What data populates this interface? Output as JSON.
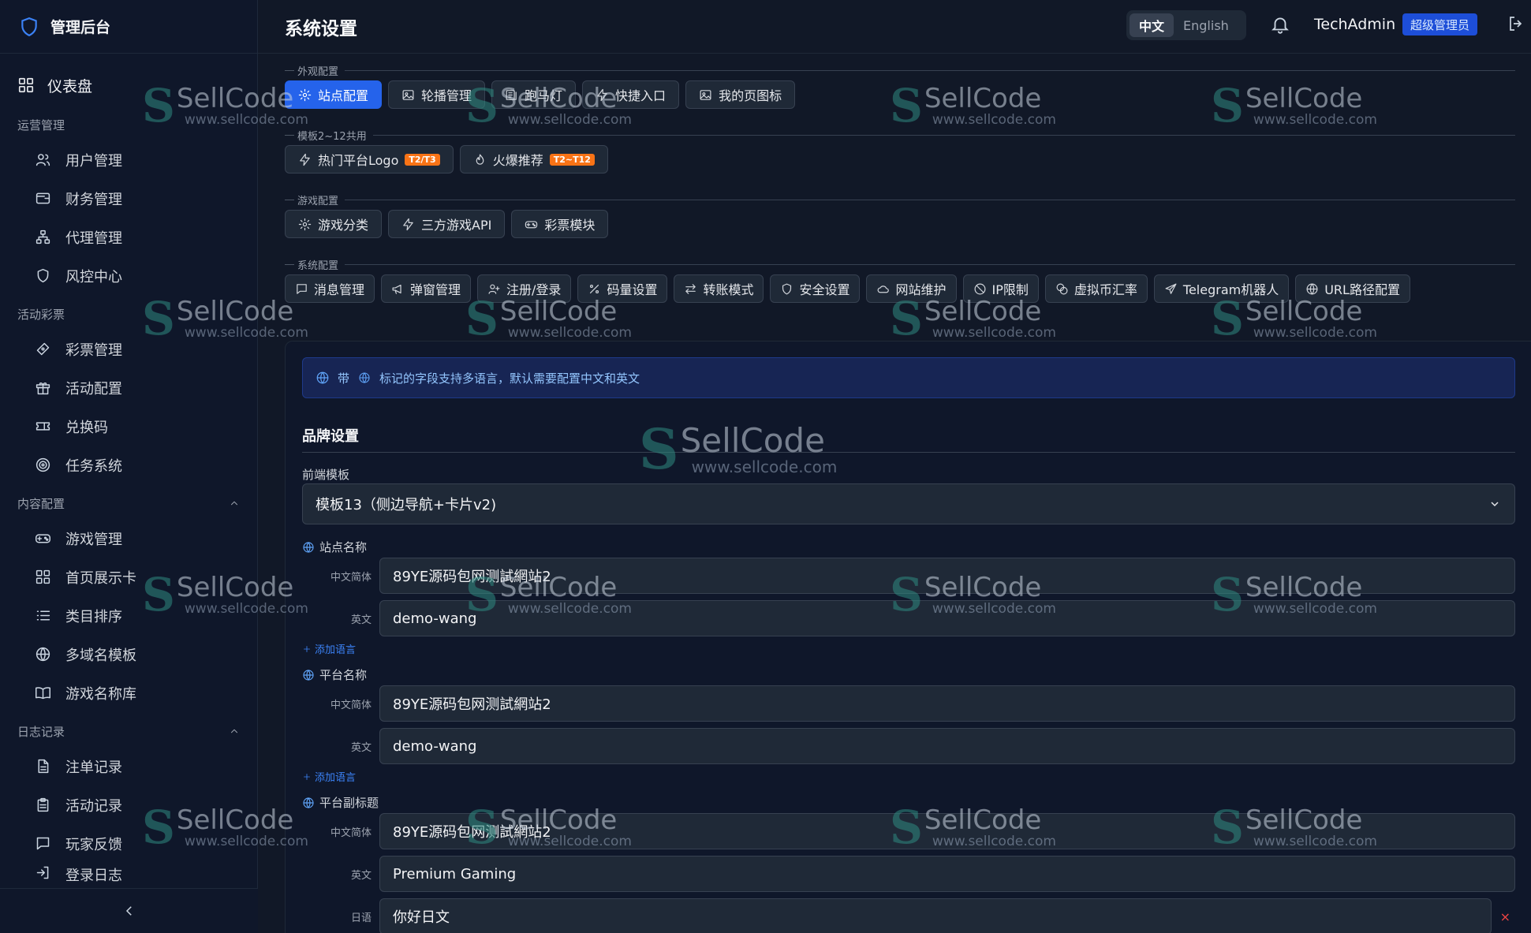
{
  "colors": {
    "accent": "#2563eb",
    "tag": "#f97316",
    "watermark": "#2f8a80",
    "danger": "#ef4444"
  },
  "sidebar": {
    "brand": "管理后台",
    "dashboard": {
      "label": "仪表盘",
      "icon": "grid-icon"
    },
    "groups": [
      {
        "title": "运营管理",
        "items": [
          {
            "label": "用户管理",
            "icon": "users-icon"
          },
          {
            "label": "财务管理",
            "icon": "wallet-icon"
          },
          {
            "label": "代理管理",
            "icon": "network-icon"
          },
          {
            "label": "风控中心",
            "icon": "shield-icon"
          }
        ]
      },
      {
        "title": "活动彩票",
        "items": [
          {
            "label": "彩票管理",
            "icon": "lottery-icon"
          },
          {
            "label": "活动配置",
            "icon": "gift-icon"
          },
          {
            "label": "兑换码",
            "icon": "ticket-icon"
          },
          {
            "label": "任务系统",
            "icon": "target-icon"
          }
        ]
      },
      {
        "title": "内容配置",
        "items": [
          {
            "label": "游戏管理",
            "icon": "gamepad-icon"
          },
          {
            "label": "首页展示卡",
            "icon": "grid-icon"
          },
          {
            "label": "类目排序",
            "icon": "list-icon"
          },
          {
            "label": "多域名模板",
            "icon": "globe-icon"
          },
          {
            "label": "游戏名称库",
            "icon": "book-icon"
          }
        ]
      },
      {
        "title": "日志记录",
        "items": [
          {
            "label": "注单记录",
            "icon": "document-icon"
          },
          {
            "label": "活动记录",
            "icon": "clipboard-icon"
          },
          {
            "label": "玩家反馈",
            "icon": "message-icon"
          },
          {
            "label": "登录日志",
            "icon": "login-icon"
          }
        ]
      }
    ]
  },
  "header": {
    "title": "系统设置",
    "lang_zh": "中文",
    "lang_en": "English",
    "username": "TechAdmin",
    "role": "超级管理员"
  },
  "sections": [
    {
      "label": "外观配置",
      "tabs": [
        {
          "label": "站点配置",
          "icon": "gear-icon",
          "active": true
        },
        {
          "label": "轮播管理",
          "icon": "image-icon"
        },
        {
          "label": "跑马灯",
          "icon": "marquee-icon"
        },
        {
          "label": "快捷入口",
          "icon": "bolt-icon"
        },
        {
          "label": "我的页图标",
          "icon": "image-icon"
        }
      ]
    },
    {
      "label": "模板2~12共用",
      "tabs": [
        {
          "label": "热门平台Logo",
          "icon": "bolt-icon",
          "tag": "T2/T3"
        },
        {
          "label": "火爆推荐",
          "icon": "flame-icon",
          "tag": "T2~T12"
        }
      ]
    },
    {
      "label": "游戏配置",
      "tabs": [
        {
          "label": "游戏分类",
          "icon": "gear-icon"
        },
        {
          "label": "三方游戏API",
          "icon": "bolt-icon"
        },
        {
          "label": "彩票模块",
          "icon": "gamepad-icon"
        }
      ]
    },
    {
      "label": "系统配置",
      "tabs": [
        {
          "label": "消息管理",
          "icon": "message-icon"
        },
        {
          "label": "弹窗管理",
          "icon": "megaphone-icon"
        },
        {
          "label": "注册/登录",
          "icon": "user-plus-icon"
        },
        {
          "label": "码量设置",
          "icon": "percent-icon"
        },
        {
          "label": "转账模式",
          "icon": "transfer-icon"
        },
        {
          "label": "安全设置",
          "icon": "shield-icon"
        },
        {
          "label": "网站维护",
          "icon": "cloud-icon"
        },
        {
          "label": "IP限制",
          "icon": "block-icon"
        },
        {
          "label": "虚拟币汇率",
          "icon": "coins-icon"
        },
        {
          "label": "Telegram机器人",
          "icon": "send-icon"
        },
        {
          "label": "URL路径配置",
          "icon": "globe-icon"
        }
      ]
    }
  ],
  "panel": {
    "notice_prefix": "带",
    "notice_text": "标记的字段支持多语言，默认需要配置中文和英文",
    "brand_heading": "品牌设置",
    "template_label": "前端模板",
    "template_value": "模板13（侧边导航+卡片v2)",
    "add_language": "添加语言",
    "fields": [
      {
        "label": "站点名称",
        "rows": [
          {
            "lang": "中文简体",
            "value": "89YE源码包网测試網站2"
          },
          {
            "lang": "英文",
            "value": "demo-wang"
          }
        ]
      },
      {
        "label": "平台名称",
        "rows": [
          {
            "lang": "中文简体",
            "value": "89YE源码包网测試網站2"
          },
          {
            "lang": "英文",
            "value": "demo-wang"
          }
        ]
      },
      {
        "label": "平台副标题",
        "rows": [
          {
            "lang": "中文简体",
            "value": "89YE源码包网测試網站2"
          },
          {
            "lang": "英文",
            "value": "Premium Gaming"
          },
          {
            "lang": "日语",
            "value": "你好日文"
          }
        ]
      }
    ]
  },
  "watermark": {
    "brand": "SellCode",
    "url": "www.sellcode.com"
  }
}
